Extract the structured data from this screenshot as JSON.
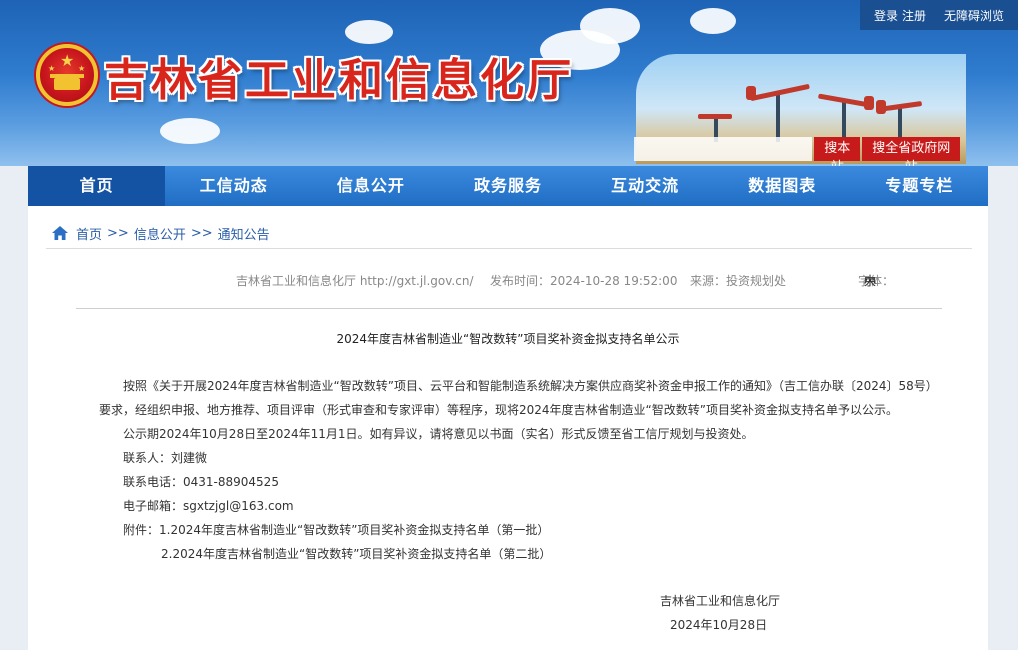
{
  "header": {
    "site_title": "吉林省工业和信息化厅",
    "links": {
      "login": "登录",
      "register": "注册",
      "accessibility": "无障碍浏览"
    },
    "search": {
      "placeholder": "",
      "search_site": "搜本站",
      "search_all": "搜全省政府网站"
    }
  },
  "nav": {
    "items": [
      {
        "label": "首页"
      },
      {
        "label": "工信动态"
      },
      {
        "label": "信息公开"
      },
      {
        "label": "政务服务"
      },
      {
        "label": "互动交流"
      },
      {
        "label": "数据图表"
      },
      {
        "label": "专题专栏"
      }
    ],
    "active_index": 0
  },
  "breadcrumb": {
    "items": [
      "首页",
      "信息公开",
      "通知公告"
    ],
    "separator": ">>"
  },
  "article": {
    "meta": {
      "source_site": "吉林省工业和信息化厅 http://gxt.jl.gov.cn/",
      "publish_time": "发布时间：2024-10-28 19:52:00",
      "origin": "来源：投资规划处",
      "font_size_label": "字体：",
      "size_large": "大",
      "size_medium": "中",
      "size_small": "小"
    },
    "title": "2024年度吉林省制造业“智改数转”项目奖补资金拟支持名单公示",
    "paragraph1": "按照《关于开展2024年度吉林省制造业“智改数转”项目、云平台和智能制造系统解决方案供应商奖补资金申报工作的通知》（吉工信办联〔2024〕58号）要求，经组织申报、地方推荐、项目评审（形式审查和专家评审）等程序，现将2024年度吉林省制造业“智改数转”项目奖补资金拟支持名单予以公示。",
    "paragraph2": "公示期2024年10月28日至2024年11月1日。如有异议，请将意见以书面（实名）形式反馈至省工信厅规划与投资处。",
    "contact": "联系人：刘建微",
    "phone": "联系电话：0431-88904525",
    "email": "电子邮箱：sgxtzjgl@163.com",
    "attachment1": "附件：1.2024年度吉林省制造业“智改数转”项目奖补资金拟支持名单（第一批）",
    "attachment2": "2.2024年度吉林省制造业“智改数转”项目奖补资金拟支持名单（第二批）",
    "sign_org": "吉林省工业和信息化厅",
    "sign_date": "2024年10月28日"
  },
  "colors": {
    "header_blue": "#1e63b5",
    "nav_blue": "#1f6ec4",
    "title_red": "#d8261d",
    "link_blue": "#2a5da8",
    "search_red": "#c71a1a"
  },
  "icons": [
    "national-emblem-icon",
    "home-icon"
  ]
}
